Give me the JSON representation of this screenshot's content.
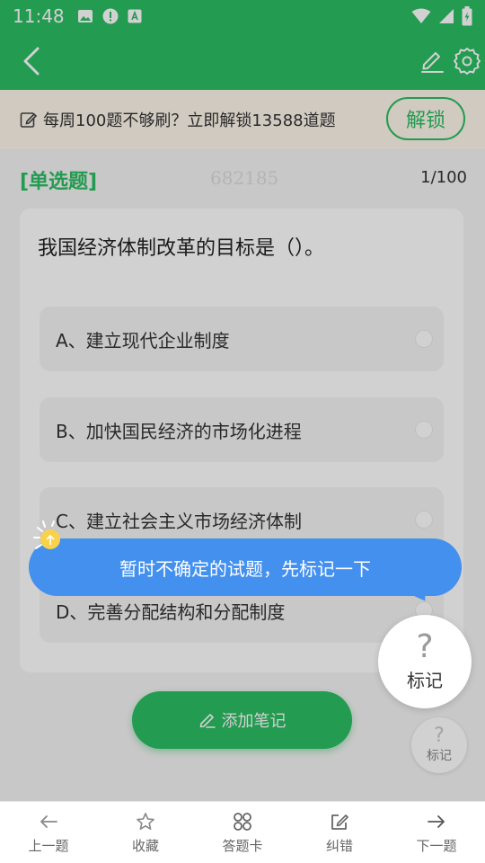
{
  "status_bar": {
    "time": "11:48"
  },
  "promo": {
    "text": "每周100题不够刷？立即解锁13588道题",
    "unlock_label": "解锁"
  },
  "question": {
    "type_label": "[单选题]",
    "id": "682185",
    "progress": "1/100",
    "text": "我国经济体制改革的目标是（）。",
    "options": [
      "A、建立现代企业制度",
      "B、加快国民经济的市场化进程",
      "C、建立社会主义市场经济体制",
      "D、完善分配结构和分配制度"
    ]
  },
  "add_note_label": "添加笔记",
  "mark": {
    "icon": "?",
    "label": "标记"
  },
  "tooltip": {
    "text": "暂时不确定的试题，先标记一下"
  },
  "bottom_nav": [
    {
      "label": "上一题",
      "icon": "arrow-left-icon"
    },
    {
      "label": "收藏",
      "icon": "star-icon"
    },
    {
      "label": "答题卡",
      "icon": "grid-icon"
    },
    {
      "label": "纠错",
      "icon": "edit-icon"
    },
    {
      "label": "下一题",
      "icon": "arrow-right-icon"
    }
  ],
  "colors": {
    "primary": "#2bbd62",
    "tooltip": "#4390ef",
    "promo_bg": "#fff7ec"
  }
}
